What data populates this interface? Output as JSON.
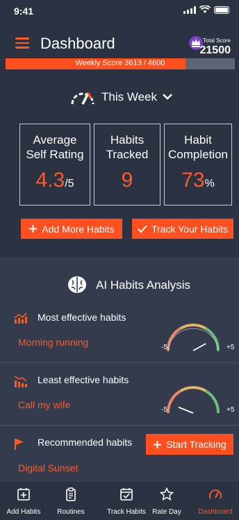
{
  "status": {
    "time": "9:41"
  },
  "header": {
    "title": "Dashboard",
    "total_score_label": "Total Score",
    "total_score_value": "21500"
  },
  "weekly": {
    "label": "Weekly Score  3613 / 4600",
    "progress": 0.785
  },
  "week_selector": {
    "label": "This Week"
  },
  "stats": [
    {
      "title_line1": "Average",
      "title_line2": "Self Rating",
      "value": "4.3",
      "unit": "/5"
    },
    {
      "title_line1": "Habits",
      "title_line2": "Tracked",
      "value": "9",
      "unit": ""
    },
    {
      "title_line1": "Habit",
      "title_line2": "Completion",
      "value": "73",
      "unit": "%"
    }
  ],
  "buttons": {
    "add_more": "Add More Habits",
    "track": "Track Your Habits",
    "start_tracking": "Start Tracking"
  },
  "ai": {
    "title": "AI Habits Analysis",
    "rows": [
      {
        "label": "Most effective habits",
        "value": "Morning running",
        "gauge_min": "-5",
        "gauge_max": "+5",
        "gauge_level": 0.75
      },
      {
        "label": "Least effective habits",
        "value": "Call my wife",
        "gauge_min": "-5",
        "gauge_max": "+5",
        "gauge_level": 0.2
      },
      {
        "label": "Recommended habits",
        "value": "Digital Sunset"
      }
    ]
  },
  "tabs": [
    {
      "label": "Add Habits",
      "icon": "add-square-icon"
    },
    {
      "label": "Routines",
      "icon": "clipboard-icon"
    },
    {
      "label": "Track Habits",
      "icon": "calendar-check-icon"
    },
    {
      "label": "Rate Day",
      "icon": "star-icon"
    },
    {
      "label": "Dashboard",
      "icon": "speedometer-icon",
      "active": true
    }
  ],
  "colors": {
    "accent": "#ff4f1f",
    "background": "#2b3242",
    "section": "#333b4c"
  }
}
